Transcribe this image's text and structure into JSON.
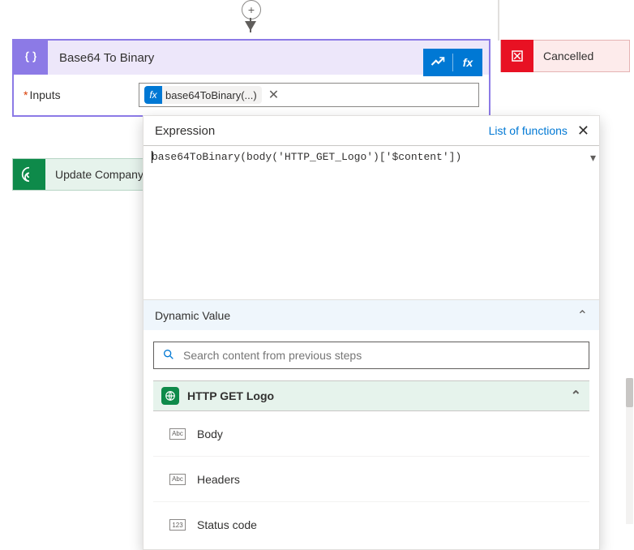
{
  "top": {
    "connector_top": true
  },
  "card": {
    "title": "Base64 To Binary",
    "input_label": "Inputs",
    "pill_text": "base64ToBinary(...)"
  },
  "cancelled": {
    "label": "Cancelled"
  },
  "update": {
    "label": "Update Company"
  },
  "popout": {
    "title": "Expression",
    "link": "List of functions",
    "expression": "base64ToBinary(body('HTTP_GET_Logo')['$content'])",
    "dv_title": "Dynamic Value",
    "search_placeholder": "Search content from previous steps",
    "step": "HTTP GET Logo",
    "items": [
      "Body",
      "Headers",
      "Status code"
    ],
    "badge0": "Abc",
    "badge1": "Abc",
    "badge2": "123"
  }
}
